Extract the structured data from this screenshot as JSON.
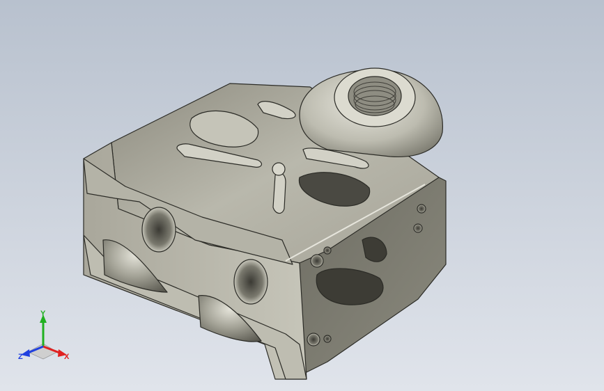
{
  "viewport": {
    "background_top": "#b9c2cf",
    "background_bottom": "#dfe3ea"
  },
  "model": {
    "metal_light": "#c9c8bd",
    "metal_mid": "#9d9b8f",
    "metal_dark": "#5c5b52",
    "edge": "#2b2b26",
    "component": "bracket-part"
  },
  "triad": {
    "x_label": "X",
    "y_label": "Y",
    "z_label": "Z",
    "x_color": "#e02020",
    "y_color": "#20b020",
    "z_color": "#2040e0"
  }
}
